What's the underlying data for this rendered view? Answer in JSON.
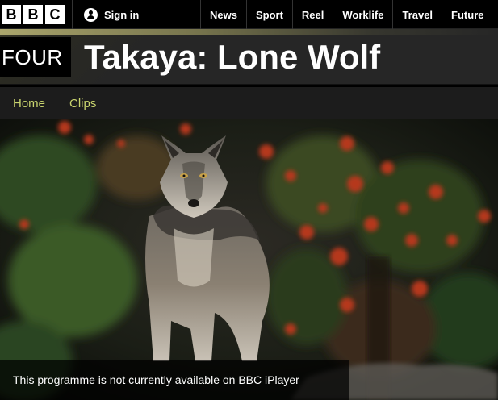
{
  "global_nav": {
    "sign_in_label": "Sign in",
    "items": [
      "News",
      "Sport",
      "Reel",
      "Worklife",
      "Travel",
      "Future"
    ]
  },
  "channel": {
    "logo_text": "FOUR",
    "accent_color": "#c9d46e"
  },
  "page": {
    "title": "Takaya: Lone Wolf"
  },
  "subnav": {
    "items": [
      "Home",
      "Clips"
    ]
  },
  "hero": {
    "image_subject": "grey wolf standing among red berry bushes",
    "availability_message": "This programme is not currently available on BBC iPlayer"
  },
  "brand": {
    "logo_letters": [
      "B",
      "B",
      "C"
    ]
  }
}
